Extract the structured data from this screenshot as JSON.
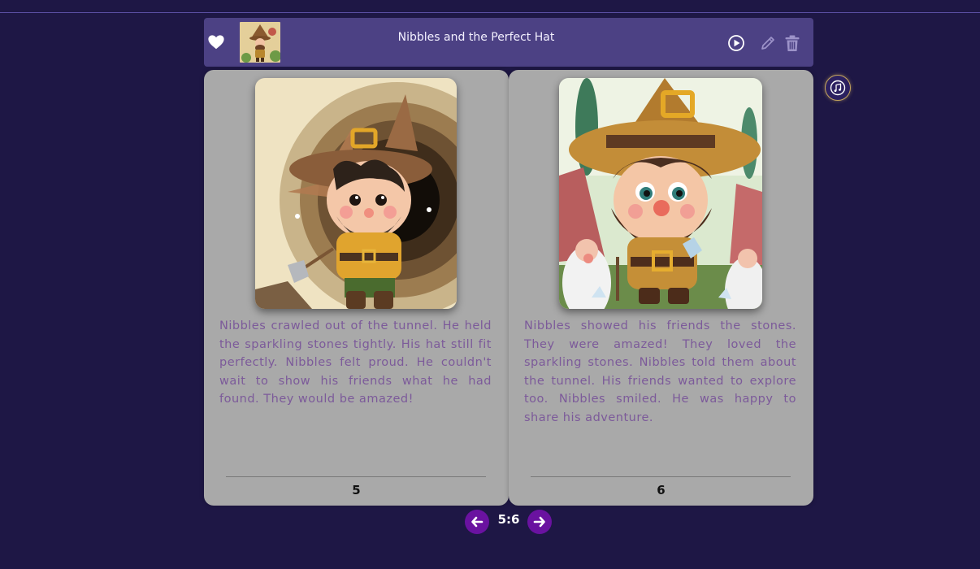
{
  "book": {
    "title": "Nibbles and the Perfect Hat"
  },
  "header": {
    "icons": {
      "favorite": "heart-icon",
      "play": "play-icon",
      "edit": "pencil-icon",
      "delete": "trash-icon",
      "music": "music-note-icon"
    }
  },
  "pages": [
    {
      "number": "5",
      "text": "Nibbles crawled out of the tunnel. He held the sparkling stones tightly. His hat still fit perfectly. Nibbles felt proud. He couldn't wait to show his friends what he had found. They would be amazed!"
    },
    {
      "number": "6",
      "text": "Nibbles showed his friends the stones. They were amazed! They loved the sparkling stones. Nibbles told them about the tunnel. His friends wanted to explore too. Nibbles smiled. He was happy to share his adventure."
    }
  ],
  "pager": {
    "current": "5:6",
    "prev_icon": "arrow-left-icon",
    "next_icon": "arrow-right-icon"
  },
  "colors": {
    "background": "#1e1745",
    "header": "#4c4184",
    "page": "#a9a9a9",
    "story_text": "#7c5a9a",
    "nav_button": "#6a12a0"
  }
}
